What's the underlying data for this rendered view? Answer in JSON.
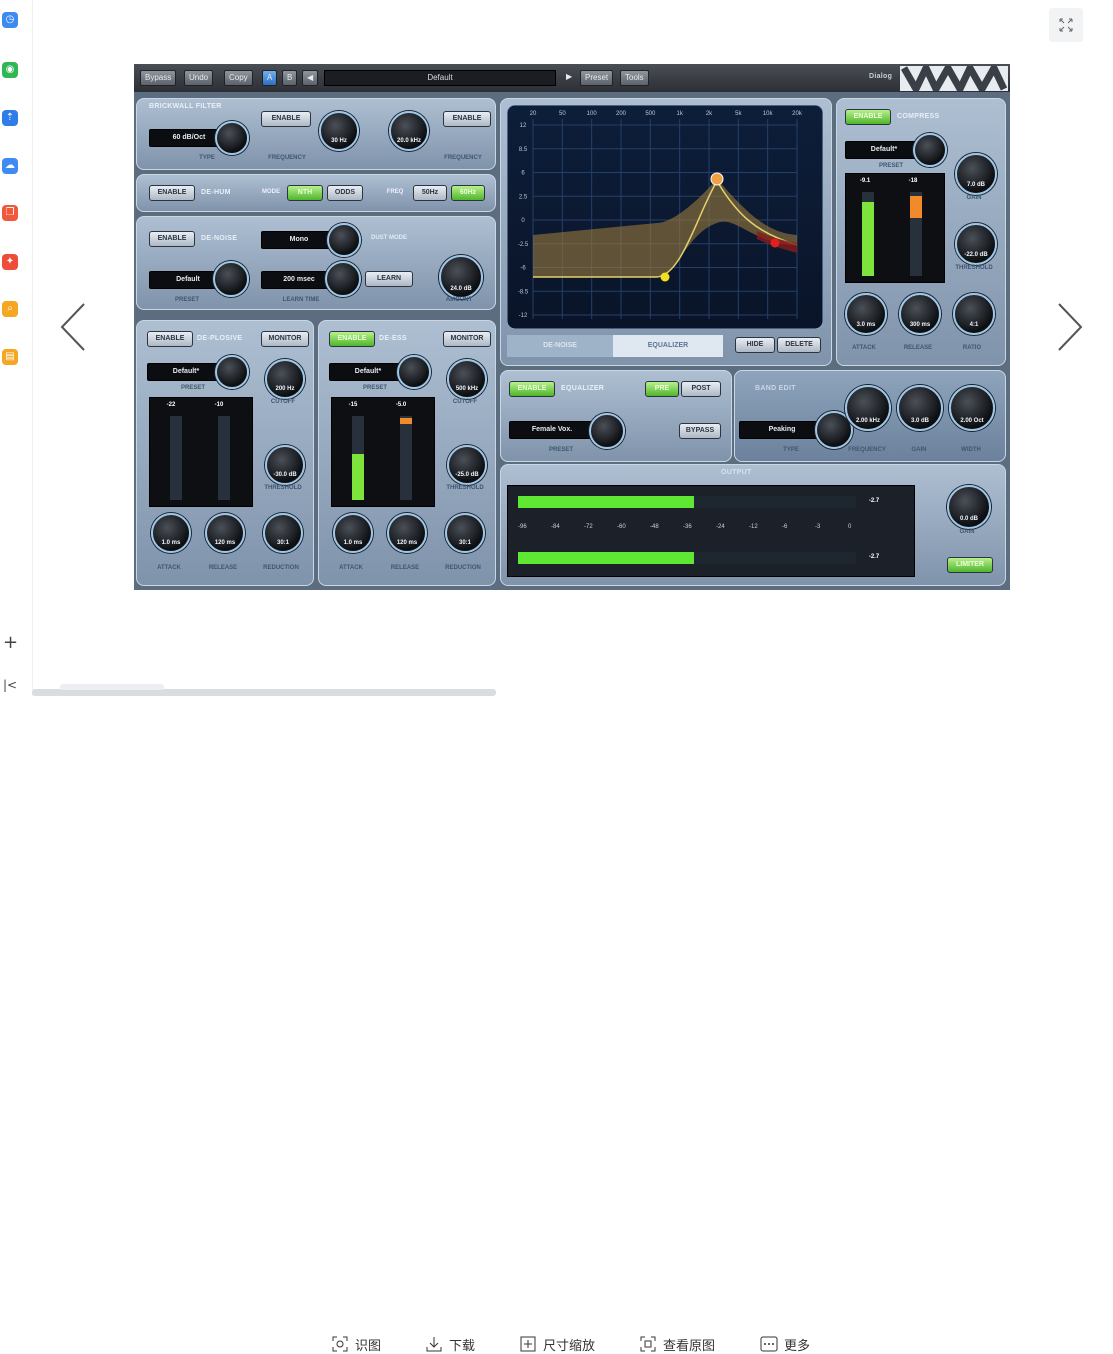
{
  "viewer": {
    "toolbar": [
      {
        "name": "ocr",
        "label": "识图"
      },
      {
        "name": "download",
        "label": "下载"
      },
      {
        "name": "resize",
        "label": "尺寸缩放"
      },
      {
        "name": "view-original",
        "label": "查看原图"
      },
      {
        "name": "more",
        "label": "更多"
      }
    ],
    "sidebar_apps": [
      {
        "name": "clock-app-icon",
        "color": "#3d8bf0"
      },
      {
        "name": "wechat-app-icon",
        "color": "#2fb754"
      },
      {
        "name": "upload-app-icon",
        "color": "#2f7de8"
      },
      {
        "name": "cloud-app-icon",
        "color": "#3e8cf3"
      },
      {
        "name": "copy-app-icon",
        "color": "#f0593b"
      },
      {
        "name": "pdf-app-icon",
        "color": "#ef4d3a"
      },
      {
        "name": "search-app-icon",
        "color": "#f5a623"
      },
      {
        "name": "book-app-icon",
        "color": "#f5a623"
      }
    ]
  },
  "plugin": {
    "topbar": {
      "bypass": "Bypass",
      "undo": "Undo",
      "copy": "Copy",
      "ab": "A",
      "b": "B",
      "preset": "Default",
      "load": "Preset",
      "save": "Tools",
      "dialog": "Dialog"
    },
    "brickwall": {
      "title": "BRICKWALL FILTER",
      "type": "60 dB/Oct",
      "type_label": "TYPE",
      "enable1": "ENABLE",
      "freq1": "30 Hz",
      "freq1_label": "FREQUENCY",
      "enable2": "ENABLE",
      "freq2": "20.0 kHz",
      "freq2_label": "FREQUENCY"
    },
    "dehum": {
      "enable": "ENABLE",
      "title": "DE-HUM",
      "mode_label": "MODE",
      "mode_a": "NTH",
      "mode_b": "ODDS",
      "freq_label": "FREQ",
      "freq_a": "50Hz",
      "freq_b": "60Hz"
    },
    "denoise": {
      "enable": "ENABLE",
      "title": "DE-NOISE",
      "mode": "Mono",
      "mode_label": "DUST MODE",
      "preset": "Default",
      "preset_label": "PRESET",
      "learn_time": "200 msec",
      "learn_time_label": "LEARN TIME",
      "learn": "LEARN",
      "amount": "24.0 dB",
      "amount_label": "AMOUNT"
    },
    "deplosive": {
      "enable": "ENABLE",
      "title": "DE-PLOSIVE",
      "monitor": "MONITOR",
      "preset": "Default*",
      "preset_label": "PRESET",
      "meter_in": "-22",
      "meter_out": "-10",
      "freq": "200 Hz",
      "freq_label": "CUTOFF",
      "thresh": "-30.0 dB",
      "thresh_label": "THRESHOLD",
      "attack": "1.0 ms",
      "attack_label": "ATTACK",
      "release": "120 ms",
      "release_label": "RELEASE",
      "reduction": "30:1",
      "reduction_label": "REDUCTION"
    },
    "deess": {
      "enable": "ENABLE",
      "title": "DE-ESS",
      "monitor": "MONITOR",
      "preset": "Default*",
      "preset_label": "PRESET",
      "meter_in": "-15",
      "meter_out": "-5.0",
      "freq": "500 kHz",
      "freq_label": "CUTOFF",
      "thresh": "-25.0 dB",
      "thresh_label": "THRESHOLD",
      "attack": "1.0 ms",
      "attack_label": "ATTACK",
      "release": "120 ms",
      "release_label": "RELEASE",
      "reduction": "30:1",
      "reduction_label": "REDUCTION"
    },
    "graph": {
      "x_ticks": [
        "20",
        "50",
        "100",
        "200",
        "500",
        "1k",
        "2k",
        "5k",
        "10k",
        "20k"
      ],
      "y_ticks": [
        "12",
        "8.5",
        "6",
        "2.5",
        "0",
        "-2.5",
        "-6",
        "-8.5",
        "-12"
      ],
      "tab_denoise": "DE-NOISE",
      "tab_eq": "EQUALIZER",
      "btn_hide": "HIDE",
      "btn_delete": "DELETE"
    },
    "equalizer": {
      "enable": "ENABLE",
      "title": "EQUALIZER",
      "pre": "PRE",
      "post": "POST",
      "bypass": "BYPASS",
      "preset": "Female Vox.",
      "preset_label": "PRESET"
    },
    "band": {
      "title": "BAND EDIT",
      "type": "Peaking",
      "type_label": "TYPE",
      "freq": "2.00 kHz",
      "freq_label": "FREQUENCY",
      "gain": "3.0 dB",
      "gain_label": "GAIN",
      "width": "2.00 Oct",
      "width_label": "WIDTH"
    },
    "compress": {
      "enable": "ENABLE",
      "title": "COMPRESS",
      "preset": "Default*",
      "preset_label": "PRESET",
      "meter_in": "-9.1",
      "meter_out": "-18",
      "gain": "7.0 dB",
      "gain_label": "GAIN",
      "thresh": "-22.0 dB",
      "thresh_label": "THRESHOLD",
      "attack": "3.0 ms",
      "attack_label": "ATTACK",
      "release": "300 ms",
      "release_label": "RELEASE",
      "knee": "4:1",
      "knee_label": "RATIO"
    },
    "output": {
      "title": "OUTPUT",
      "peak_l": "-2.7",
      "peak_r": "-2.7",
      "scale": [
        "-96",
        "-84",
        "-72",
        "-60",
        "-48",
        "-36",
        "-24",
        "-12",
        "-6",
        "-3",
        "0"
      ],
      "gain": "0.0 dB",
      "gain_label": "GAIN",
      "limiter": "LIMITER",
      "level": 0.4
    }
  }
}
